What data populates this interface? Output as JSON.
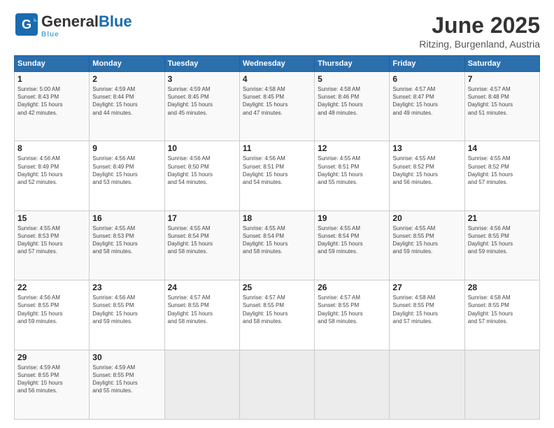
{
  "header": {
    "logo_general": "General",
    "logo_blue": "Blue",
    "month": "June 2025",
    "location": "Ritzing, Burgenland, Austria"
  },
  "weekdays": [
    "Sunday",
    "Monday",
    "Tuesday",
    "Wednesday",
    "Thursday",
    "Friday",
    "Saturday"
  ],
  "weeks": [
    [
      {
        "day": "1",
        "info": "Sunrise: 5:00 AM\nSunset: 8:43 PM\nDaylight: 15 hours\nand 42 minutes."
      },
      {
        "day": "2",
        "info": "Sunrise: 4:59 AM\nSunset: 8:44 PM\nDaylight: 15 hours\nand 44 minutes."
      },
      {
        "day": "3",
        "info": "Sunrise: 4:59 AM\nSunset: 8:45 PM\nDaylight: 15 hours\nand 45 minutes."
      },
      {
        "day": "4",
        "info": "Sunrise: 4:58 AM\nSunset: 8:45 PM\nDaylight: 15 hours\nand 47 minutes."
      },
      {
        "day": "5",
        "info": "Sunrise: 4:58 AM\nSunset: 8:46 PM\nDaylight: 15 hours\nand 48 minutes."
      },
      {
        "day": "6",
        "info": "Sunrise: 4:57 AM\nSunset: 8:47 PM\nDaylight: 15 hours\nand 49 minutes."
      },
      {
        "day": "7",
        "info": "Sunrise: 4:57 AM\nSunset: 8:48 PM\nDaylight: 15 hours\nand 51 minutes."
      }
    ],
    [
      {
        "day": "8",
        "info": "Sunrise: 4:56 AM\nSunset: 8:49 PM\nDaylight: 15 hours\nand 52 minutes."
      },
      {
        "day": "9",
        "info": "Sunrise: 4:56 AM\nSunset: 8:49 PM\nDaylight: 15 hours\nand 53 minutes."
      },
      {
        "day": "10",
        "info": "Sunrise: 4:56 AM\nSunset: 8:50 PM\nDaylight: 15 hours\nand 54 minutes."
      },
      {
        "day": "11",
        "info": "Sunrise: 4:56 AM\nSunset: 8:51 PM\nDaylight: 15 hours\nand 54 minutes."
      },
      {
        "day": "12",
        "info": "Sunrise: 4:55 AM\nSunset: 8:51 PM\nDaylight: 15 hours\nand 55 minutes."
      },
      {
        "day": "13",
        "info": "Sunrise: 4:55 AM\nSunset: 8:52 PM\nDaylight: 15 hours\nand 56 minutes."
      },
      {
        "day": "14",
        "info": "Sunrise: 4:55 AM\nSunset: 8:52 PM\nDaylight: 15 hours\nand 57 minutes."
      }
    ],
    [
      {
        "day": "15",
        "info": "Sunrise: 4:55 AM\nSunset: 8:53 PM\nDaylight: 15 hours\nand 57 minutes."
      },
      {
        "day": "16",
        "info": "Sunrise: 4:55 AM\nSunset: 8:53 PM\nDaylight: 15 hours\nand 58 minutes."
      },
      {
        "day": "17",
        "info": "Sunrise: 4:55 AM\nSunset: 8:54 PM\nDaylight: 15 hours\nand 58 minutes."
      },
      {
        "day": "18",
        "info": "Sunrise: 4:55 AM\nSunset: 8:54 PM\nDaylight: 15 hours\nand 58 minutes."
      },
      {
        "day": "19",
        "info": "Sunrise: 4:55 AM\nSunset: 8:54 PM\nDaylight: 15 hours\nand 59 minutes."
      },
      {
        "day": "20",
        "info": "Sunrise: 4:55 AM\nSunset: 8:55 PM\nDaylight: 15 hours\nand 59 minutes."
      },
      {
        "day": "21",
        "info": "Sunrise: 4:56 AM\nSunset: 8:55 PM\nDaylight: 15 hours\nand 59 minutes."
      }
    ],
    [
      {
        "day": "22",
        "info": "Sunrise: 4:56 AM\nSunset: 8:55 PM\nDaylight: 15 hours\nand 59 minutes."
      },
      {
        "day": "23",
        "info": "Sunrise: 4:56 AM\nSunset: 8:55 PM\nDaylight: 15 hours\nand 59 minutes."
      },
      {
        "day": "24",
        "info": "Sunrise: 4:57 AM\nSunset: 8:55 PM\nDaylight: 15 hours\nand 58 minutes."
      },
      {
        "day": "25",
        "info": "Sunrise: 4:57 AM\nSunset: 8:55 PM\nDaylight: 15 hours\nand 58 minutes."
      },
      {
        "day": "26",
        "info": "Sunrise: 4:57 AM\nSunset: 8:55 PM\nDaylight: 15 hours\nand 58 minutes."
      },
      {
        "day": "27",
        "info": "Sunrise: 4:58 AM\nSunset: 8:55 PM\nDaylight: 15 hours\nand 57 minutes."
      },
      {
        "day": "28",
        "info": "Sunrise: 4:58 AM\nSunset: 8:55 PM\nDaylight: 15 hours\nand 57 minutes."
      }
    ],
    [
      {
        "day": "29",
        "info": "Sunrise: 4:59 AM\nSunset: 8:55 PM\nDaylight: 15 hours\nand 56 minutes."
      },
      {
        "day": "30",
        "info": "Sunrise: 4:59 AM\nSunset: 8:55 PM\nDaylight: 15 hours\nand 55 minutes."
      },
      {
        "day": "",
        "info": ""
      },
      {
        "day": "",
        "info": ""
      },
      {
        "day": "",
        "info": ""
      },
      {
        "day": "",
        "info": ""
      },
      {
        "day": "",
        "info": ""
      }
    ]
  ]
}
